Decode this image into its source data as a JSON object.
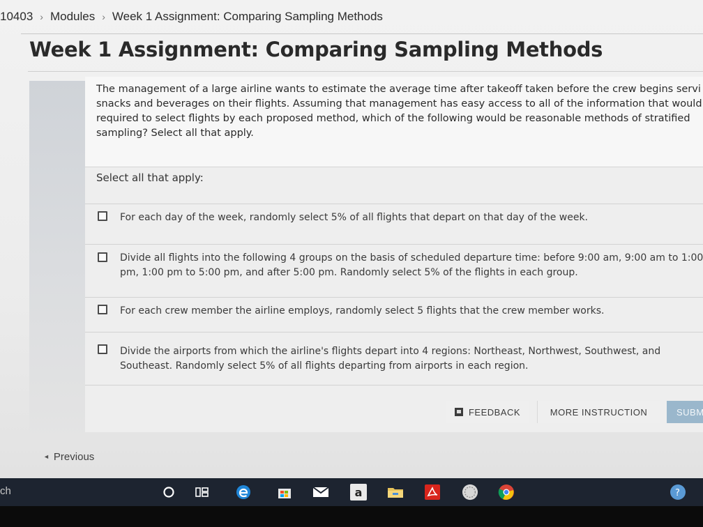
{
  "breadcrumb": {
    "course": "10403",
    "modules": "Modules",
    "current": "Week 1 Assignment: Comparing Sampling Methods"
  },
  "page_title": "Week 1 Assignment: Comparing Sampling Methods",
  "question": {
    "text": "The management of a large airline wants to estimate the average time after takeoff taken before the crew begins servi snacks and beverages on their flights. Assuming that management has easy access to all of the information that would required to select flights by each proposed method, which of the following would be reasonable methods of stratified sampling? Select all that apply."
  },
  "answers": {
    "instruction": "Select all that apply:",
    "options": [
      {
        "label": "For each day of the week, randomly select 5% of all flights that depart on that day of the week.",
        "checked": false
      },
      {
        "label": "Divide all flights into the following 4 groups on the basis of scheduled departure time: before 9:00 am, 9:00 am to 1:00 pm, 1:00 pm to 5:00 pm, and after 5:00 pm. Randomly select 5% of the flights in each group.",
        "checked": false
      },
      {
        "label": "For each crew member the airline employs, randomly select 5 flights that the crew member works.",
        "checked": false
      },
      {
        "label": "Divide the airports from which the airline's flights depart into 4 regions: Northeast, Northwest, Southwest, and Southeast. Randomly select 5% of all flights departing from airports in each region.",
        "checked": false
      }
    ]
  },
  "footer": {
    "feedback_label": "FEEDBACK",
    "more_instruction_label": "MORE INSTRUCTION",
    "submit_label": "SUBM"
  },
  "nav": {
    "previous_label": "Previous"
  },
  "taskbar": {
    "search_text": "ch",
    "icons": [
      "cortana-icon",
      "task-view-icon",
      "edge-icon",
      "store-icon",
      "mail-icon",
      "amazon-icon",
      "file-explorer-icon",
      "acrobat-icon",
      "app-icon",
      "chrome-icon",
      "help-icon"
    ],
    "amazon_glyph": "a"
  },
  "colors": {
    "submit_bg": "#9ab7cc",
    "taskbar_bg": "#1d2430"
  }
}
